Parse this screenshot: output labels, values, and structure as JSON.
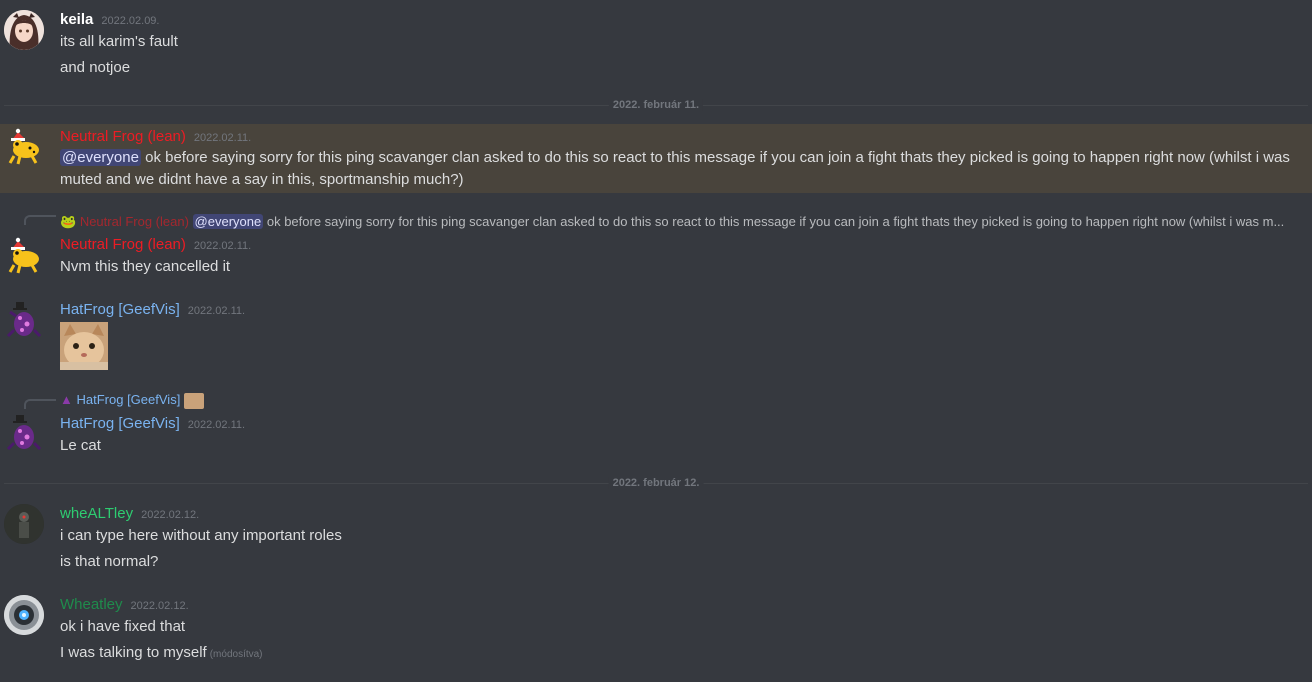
{
  "messages": [
    {
      "user": "keila",
      "color": "#ffffff",
      "time": "2022.02.09.",
      "lines": [
        "its all karim's fault",
        "and notjoe"
      ]
    },
    {
      "user": "Neutral Frog (lean)",
      "color": "#ed1c24",
      "time": "2022.02.11.",
      "mention": "@everyone",
      "text": "ok before saying sorry for this ping scavanger clan asked to do this so react to this message if you can join a fight thats they picked is going to happen right now (whilst i was muted and we didnt have a say in this, sportmanship much?)"
    },
    {
      "reply": {
        "user": "Neutral Frog (lean)",
        "mention": "@everyone",
        "text": "ok before saying sorry for this ping scavanger clan asked to do this so react to this message if you can join a fight thats they picked is going to happen right now (whilst i was m..."
      },
      "user": "Neutral Frog (lean)",
      "color": "#ed1c24",
      "time": "2022.02.11.",
      "lines": [
        "Nvm this they cancelled it"
      ]
    },
    {
      "user": "HatFrog [GeefVis]",
      "color": "#7ab3f0",
      "time": "2022.02.11.",
      "image": "cat-emoji"
    },
    {
      "reply": {
        "user": "HatFrog [GeefVis]"
      },
      "user": "HatFrog [GeefVis]",
      "color": "#7ab3f0",
      "time": "2022.02.11.",
      "lines": [
        "Le cat"
      ]
    },
    {
      "user": "wheALTley",
      "color": "#2ecc71",
      "time": "2022.02.12.",
      "lines": [
        "i can type here without any important roles",
        "is that normal?"
      ]
    },
    {
      "user": "Wheatley",
      "color": "#1f8b4c",
      "time": "2022.02.12.",
      "lines": [
        "ok i have fixed that",
        "I was talking to myself"
      ],
      "edited": "(módosítva)"
    }
  ],
  "dividers": [
    "2022. február 11.",
    "2022. február 12."
  ],
  "icons": {
    "keila": "anime-avatar",
    "neutral": "frog-santa-avatar",
    "hatfrog": "frog-hat-avatar",
    "wheALTley": "figure-avatar",
    "wheatley": "robot-eye-avatar",
    "cat": "cat-emoji"
  }
}
